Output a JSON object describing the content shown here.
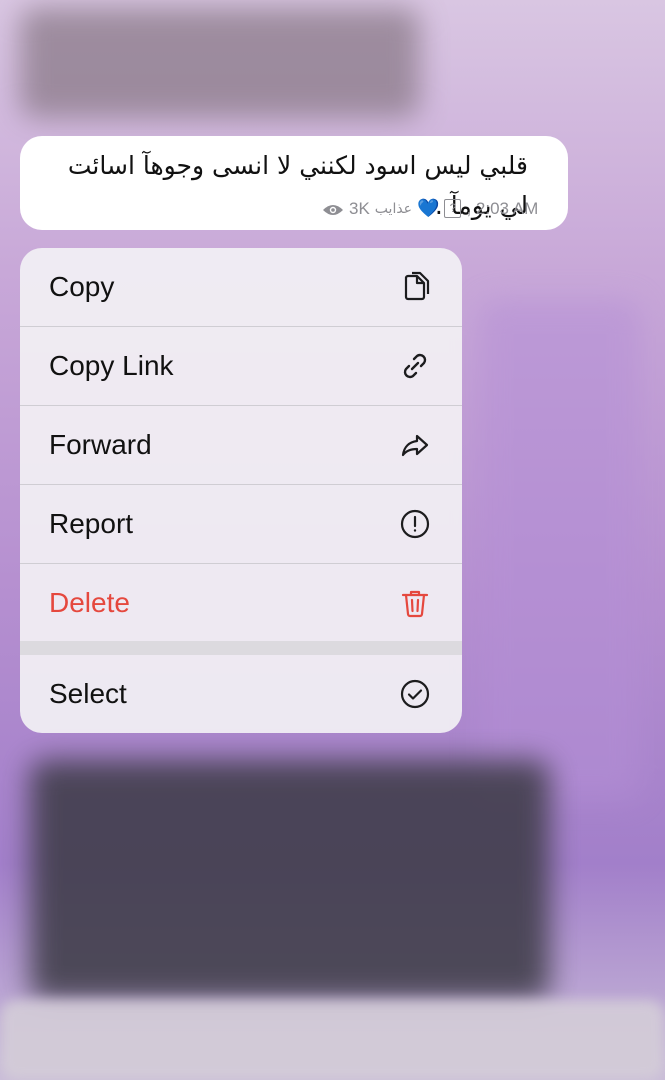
{
  "message": {
    "text": "قلبي ليس اسود لكنني لا انسى وجوهآ اسائت لي يومآ .",
    "views": "3K",
    "author": "عذايب",
    "heart": "💙",
    "unknown_glyph": "?",
    "time": ", 2:03 AM",
    "eye_icon": "eye-icon"
  },
  "menu": {
    "items": [
      {
        "label": "Copy",
        "icon": "copy-icon"
      },
      {
        "label": "Copy Link",
        "icon": "link-icon"
      },
      {
        "label": "Forward",
        "icon": "forward-icon"
      },
      {
        "label": "Report",
        "icon": "report-icon"
      },
      {
        "label": "Delete",
        "icon": "trash-icon",
        "color": "#e5483e"
      },
      {
        "label": "Select",
        "icon": "checkmark-circle-icon"
      }
    ]
  }
}
